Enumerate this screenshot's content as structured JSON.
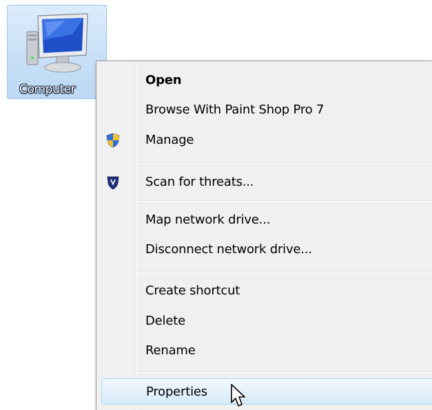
{
  "desktop": {
    "icon_label": "Computer",
    "icon_name": "computer-icon"
  },
  "context_menu": {
    "items": [
      {
        "label": "Open",
        "bold": true,
        "icon": null
      },
      {
        "label": "Browse With Paint Shop Pro 7",
        "bold": false,
        "icon": null
      },
      {
        "label": "Manage",
        "bold": false,
        "icon": "uac-shield-icon"
      },
      {
        "label": "Scan for threats...",
        "bold": false,
        "icon": "antivirus-shield-icon"
      },
      {
        "label": "Map network drive...",
        "bold": false,
        "icon": null
      },
      {
        "label": "Disconnect network drive...",
        "bold": false,
        "icon": null
      },
      {
        "label": "Create shortcut",
        "bold": false,
        "icon": null
      },
      {
        "label": "Delete",
        "bold": false,
        "icon": null
      },
      {
        "label": "Rename",
        "bold": false,
        "icon": null
      },
      {
        "label": "Properties",
        "bold": false,
        "icon": null,
        "hovered": true
      }
    ]
  },
  "colors": {
    "menu_background": "#f0f0f0",
    "hover_border": "#a8d8eb",
    "icon_selection": "#c8e0f7"
  },
  "cursor": {
    "icon": "arrow-cursor-icon"
  }
}
